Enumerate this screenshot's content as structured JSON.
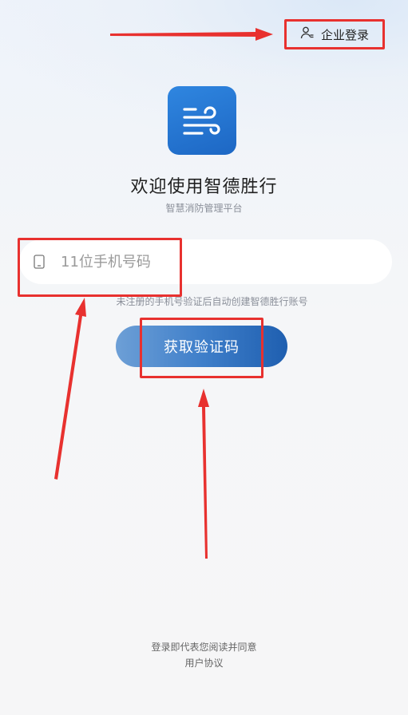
{
  "header": {
    "enterprise_login": "企业登录",
    "enterprise_icon": "user-settings-icon"
  },
  "brand": {
    "logo_icon": "wind-lines-logo",
    "title": "欢迎使用智德胜行",
    "subtitle": "智慧消防管理平台"
  },
  "login": {
    "phone_icon": "phone-icon",
    "phone_placeholder": "11位手机号码",
    "hint": "未注册的手机号验证后自动创建智德胜行账号",
    "get_code_label": "获取验证码"
  },
  "footer": {
    "agreement_text": "登录即代表您阅读并同意",
    "agreement_link": "用户协议"
  },
  "colors": {
    "brand_blue": "#1d67c4",
    "annotation_red": "#e8312f"
  }
}
